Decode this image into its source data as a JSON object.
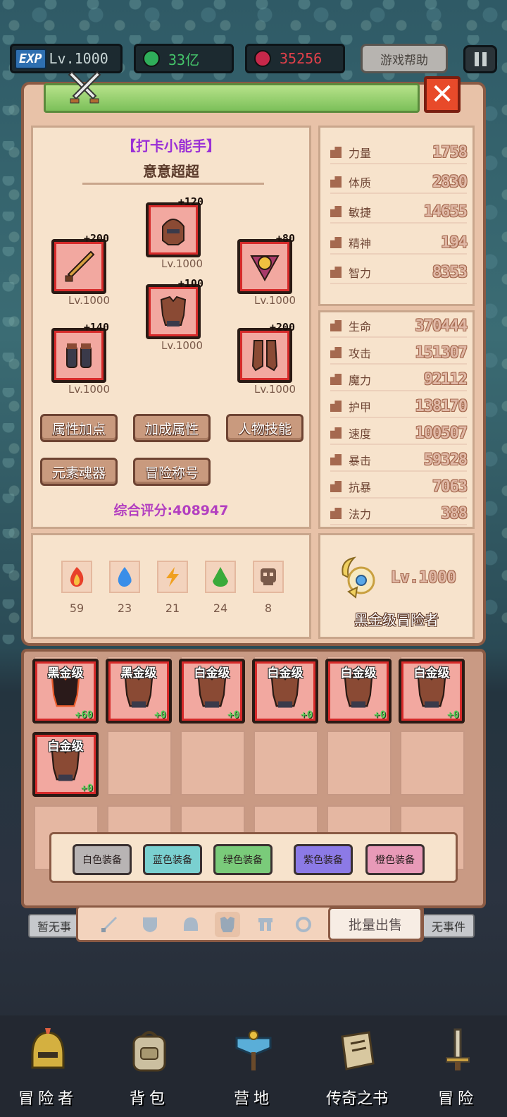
{
  "topbar": {
    "exp_label": "EXP",
    "level": "Lv.1000",
    "gems": "33亿",
    "rubies": "35256",
    "help": "游戏帮助"
  },
  "character": {
    "title": "【打卡小能手】",
    "name": "意意超超",
    "equipment": [
      {
        "slot": "weapon",
        "plus": "+200",
        "level": "Lv.1000"
      },
      {
        "slot": "helmet",
        "plus": "+120",
        "level": "Lv.1000"
      },
      {
        "slot": "amulet",
        "plus": "+80",
        "level": "Lv.1000"
      },
      {
        "slot": "armor",
        "plus": "+100",
        "level": "Lv.1000"
      },
      {
        "slot": "gloves",
        "plus": "+140",
        "level": "Lv.1000"
      },
      {
        "slot": "boots",
        "plus": "+200",
        "level": "Lv.1000"
      }
    ],
    "buttons": [
      "属性加点",
      "加成属性",
      "人物技能",
      "元素魂器",
      "冒险称号"
    ],
    "score": "综合评分:408947"
  },
  "base_stats": [
    {
      "label": "力量",
      "value": "1758"
    },
    {
      "label": "体质",
      "value": "2830"
    },
    {
      "label": "敏捷",
      "value": "14655"
    },
    {
      "label": "精神",
      "value": "194"
    },
    {
      "label": "智力",
      "value": "8353"
    }
  ],
  "combat_stats": [
    {
      "label": "生命",
      "value": "370444"
    },
    {
      "label": "攻击",
      "value": "151307"
    },
    {
      "label": "魔力",
      "value": "92112"
    },
    {
      "label": "护甲",
      "value": "138170"
    },
    {
      "label": "速度",
      "value": "100507"
    },
    {
      "label": "暴击",
      "value": "59328"
    },
    {
      "label": "抗暴",
      "value": "7063"
    },
    {
      "label": "法力",
      "value": "388"
    }
  ],
  "elements": [
    {
      "name": "fire",
      "count": "59",
      "color": "#e8402a"
    },
    {
      "name": "water",
      "count": "23",
      "color": "#3a8ee8"
    },
    {
      "name": "thunder",
      "count": "21",
      "color": "#f0a020"
    },
    {
      "name": "earth",
      "count": "24",
      "color": "#3aaa3a"
    },
    {
      "name": "dark",
      "count": "8",
      "color": "#7a5a4a"
    }
  ],
  "rank": {
    "level": "Lv.1000",
    "name": "黑金级冒险者"
  },
  "inventory": [
    {
      "grade": "黑金级",
      "enh": "+60",
      "dark": true
    },
    {
      "grade": "黑金级",
      "enh": "+0"
    },
    {
      "grade": "白金级",
      "enh": "+0"
    },
    {
      "grade": "白金级",
      "enh": "+0"
    },
    {
      "grade": "白金级",
      "enh": "+0"
    },
    {
      "grade": "白金级",
      "enh": "+0"
    },
    {
      "grade": "白金级",
      "enh": "+0"
    }
  ],
  "filters": [
    {
      "label": "白色装备",
      "color": "#b8b4b4"
    },
    {
      "label": "蓝色装备",
      "color": "#7ad0d0"
    },
    {
      "label": "绿色装备",
      "color": "#7acb7a"
    },
    {
      "label": "紫色装备",
      "color": "#8c7ae6"
    },
    {
      "label": "橙色装备",
      "color": "#e89ab8"
    }
  ],
  "sell_button": "批量出售",
  "events": {
    "left": "暂无事",
    "right": "无事件"
  },
  "nav": [
    "冒险者",
    "背包",
    "营地",
    "传奇之书",
    "冒险"
  ]
}
